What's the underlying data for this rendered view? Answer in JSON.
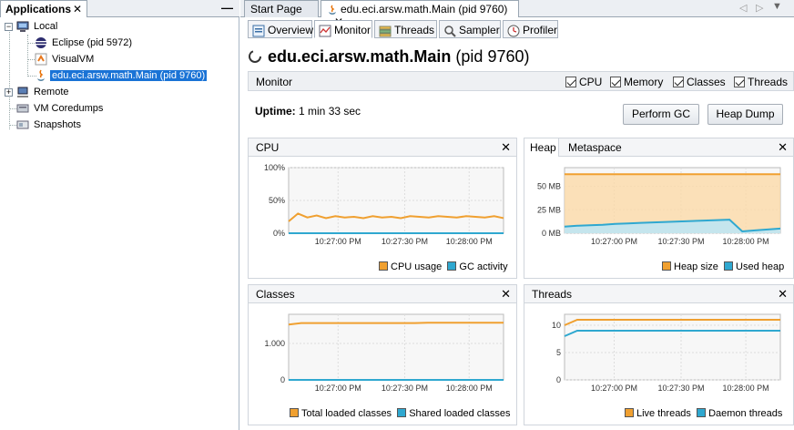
{
  "left": {
    "tab_label": "Applications",
    "close": "✕",
    "minimize": "—",
    "tree": {
      "local": "Local",
      "eclipse": "Eclipse (pid 5972)",
      "visualvm": "VisualVM",
      "main": "edu.eci.arsw.math.Main (pid 9760)",
      "remote": "Remote",
      "coredumps": "VM Coredumps",
      "snapshots": "Snapshots"
    }
  },
  "doc_tabs": {
    "start": "Start Page",
    "main": "edu.eci.arsw.math.Main (pid 9760)",
    "close": "✕"
  },
  "sub_tabs": [
    "Overview",
    "Monitor",
    "Threads",
    "Sampler",
    "Profiler"
  ],
  "header": {
    "title": "edu.eci.arsw.math.Main",
    "pid": "(pid 9760)"
  },
  "monitor_bar": {
    "label": "Monitor",
    "checks": [
      "CPU",
      "Memory",
      "Classes",
      "Threads"
    ]
  },
  "uptime": {
    "label": "Uptime:",
    "value": "1 min 33 sec"
  },
  "buttons": {
    "gc": "Perform GC",
    "heap_dump": "Heap Dump"
  },
  "panels": {
    "cpu": "CPU",
    "heap": "Heap",
    "metaspace": "Metaspace",
    "classes": "Classes",
    "threads": "Threads",
    "close": "✕"
  },
  "colors": {
    "orange": "#f0a030",
    "blue": "#2fa8d0"
  },
  "chart_data": [
    {
      "id": "cpu",
      "type": "line",
      "x_ticks": [
        "10:27:00 PM",
        "10:27:30 PM",
        "10:28:00 PM"
      ],
      "y_ticks": [
        "100%",
        "50%",
        "0%"
      ],
      "ylim": [
        0,
        100
      ],
      "series": [
        {
          "name": "CPU usage",
          "color": "#f0a030",
          "values": [
            18,
            30,
            24,
            27,
            23,
            26,
            24,
            25,
            23,
            26,
            24,
            25,
            23,
            26,
            25,
            24,
            26,
            25,
            24,
            26,
            25,
            24,
            26,
            23
          ]
        },
        {
          "name": "GC activity",
          "color": "#2fa8d0",
          "values": [
            0,
            0,
            0,
            0,
            0,
            0,
            0,
            0,
            0,
            0,
            0,
            0,
            0,
            0,
            0,
            0,
            0,
            0,
            0,
            0,
            0,
            0,
            0,
            0
          ]
        }
      ]
    },
    {
      "id": "heap",
      "type": "area",
      "x_ticks": [
        "10:27:00 PM",
        "10:27:30 PM",
        "10:28:00 PM"
      ],
      "y_ticks": [
        "50 MB",
        "25 MB",
        "0 MB"
      ],
      "ylim": [
        0,
        70
      ],
      "series": [
        {
          "name": "Heap size",
          "color": "#f0a030",
          "values": [
            63,
            63,
            63,
            63,
            63,
            63,
            63,
            63,
            63,
            63,
            63,
            63,
            63,
            63,
            63,
            63,
            63,
            63
          ]
        },
        {
          "name": "Used heap",
          "color": "#2fa8d0",
          "values": [
            7,
            8,
            8.5,
            9,
            10,
            10.5,
            11,
            11.5,
            12,
            12.5,
            13,
            13.5,
            14,
            14.5,
            2,
            3,
            4,
            5
          ]
        }
      ]
    },
    {
      "id": "classes",
      "type": "line",
      "x_ticks": [
        "10:27:00 PM",
        "10:27:30 PM",
        "10:28:00 PM"
      ],
      "y_ticks": [
        "1.000",
        "0"
      ],
      "ylim": [
        0,
        1800
      ],
      "series": [
        {
          "name": "Total loaded classes",
          "color": "#f0a030",
          "values": [
            1520,
            1560,
            1560,
            1560,
            1560,
            1560,
            1560,
            1560,
            1560,
            1560,
            1560,
            1570,
            1570,
            1570,
            1570,
            1570,
            1570,
            1570
          ]
        },
        {
          "name": "Shared loaded classes",
          "color": "#2fa8d0",
          "values": [
            0,
            0,
            0,
            0,
            0,
            0,
            0,
            0,
            0,
            0,
            0,
            0,
            0,
            0,
            0,
            0,
            0,
            0
          ]
        }
      ]
    },
    {
      "id": "threads",
      "type": "line",
      "x_ticks": [
        "10:27:00 PM",
        "10:27:30 PM",
        "10:28:00 PM"
      ],
      "y_ticks": [
        "10",
        "5",
        "0"
      ],
      "ylim": [
        0,
        12
      ],
      "series": [
        {
          "name": "Live threads",
          "color": "#f0a030",
          "values": [
            10,
            11,
            11,
            11,
            11,
            11,
            11,
            11,
            11,
            11,
            11,
            11,
            11,
            11,
            11,
            11,
            11,
            11
          ]
        },
        {
          "name": "Daemon threads",
          "color": "#2fa8d0",
          "values": [
            8,
            9,
            9,
            9,
            9,
            9,
            9,
            9,
            9,
            9,
            9,
            9,
            9,
            9,
            9,
            9,
            9,
            9
          ]
        }
      ]
    }
  ]
}
